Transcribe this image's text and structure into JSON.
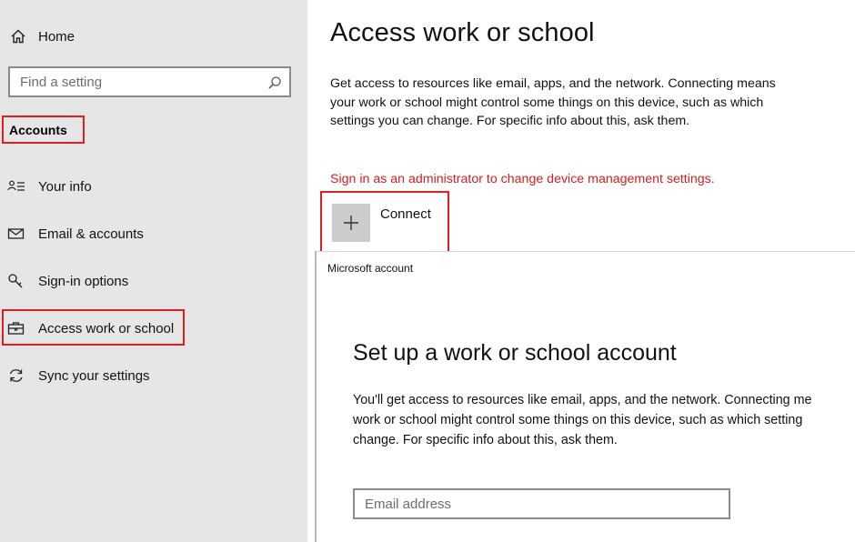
{
  "sidebar": {
    "home_label": "Home",
    "search_placeholder": "Find a setting",
    "section_title": "Accounts",
    "items": [
      {
        "label": "Your info",
        "icon": "person-list-icon"
      },
      {
        "label": "Email & accounts",
        "icon": "envelope-icon"
      },
      {
        "label": "Sign-in options",
        "icon": "key-icon"
      },
      {
        "label": "Access work or school",
        "icon": "briefcase-icon",
        "selected": true
      },
      {
        "label": "Sync your settings",
        "icon": "sync-icon"
      }
    ]
  },
  "main": {
    "title": "Access work or school",
    "description": "Get access to resources like email, apps, and the network. Connecting means your work or school might control some things on this device, such as which settings you can change. For specific info about this, ask them.",
    "admin_warning": "Sign in as an administrator to change device management settings.",
    "connect_label": "Connect"
  },
  "dialog": {
    "header": "Microsoft account",
    "title": "Set up a work or school account",
    "description_lines": [
      "You'll get access to resources like email, apps, and the network. Connecting me",
      "work or school might control some things on this device, such as which setting",
      "change. For specific info about this, ask them."
    ],
    "email_placeholder": "Email address"
  },
  "colors": {
    "sidebar_bg": "#e6e6e6",
    "highlight_red": "#e02020",
    "warning_red": "#d81e1e",
    "plus_button_bg": "#cccccc"
  }
}
